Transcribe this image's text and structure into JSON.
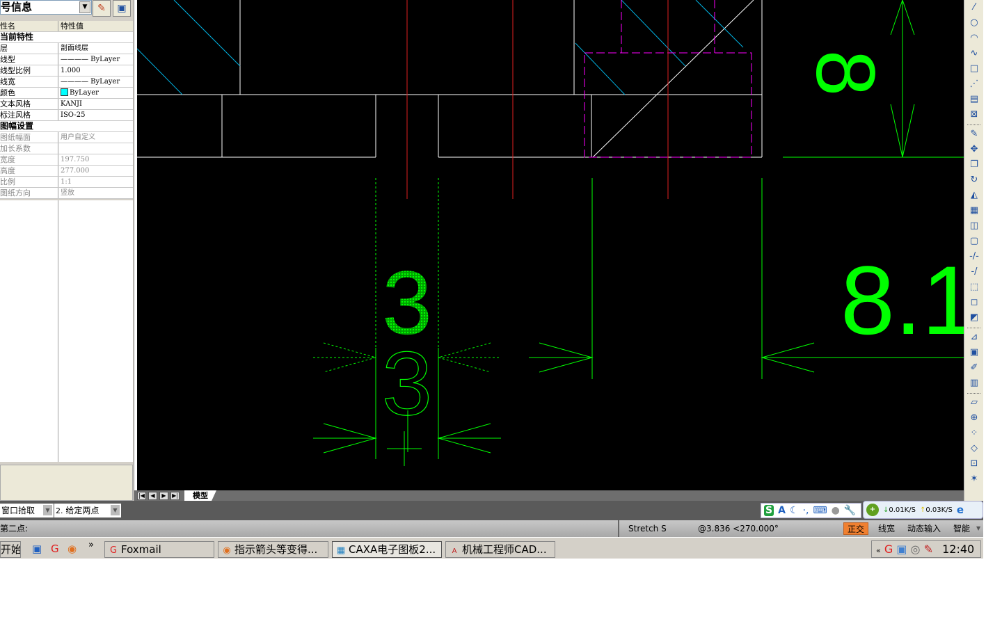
{
  "panel": {
    "title": "属性信息",
    "title_visible": "号信息",
    "col_name": "性名",
    "col_value": "特性值",
    "sections": [
      {
        "label": "当前特性",
        "rows": [
          {
            "k": "层",
            "v": "剖面线层"
          },
          {
            "k": "线型",
            "v": "———— ByLayer"
          },
          {
            "k": "线型比例",
            "v": "1.000"
          },
          {
            "k": "线宽",
            "v": "———— ByLayer"
          },
          {
            "k": "颜色",
            "v": "ByLayer",
            "swatch": "#00ffff"
          },
          {
            "k": "文本风格",
            "v": "KANJI"
          },
          {
            "k": "标注风格",
            "v": "ISO-25"
          }
        ]
      },
      {
        "label": "图幅设置",
        "rows": [
          {
            "k": "图纸幅面",
            "v": "用户自定义"
          },
          {
            "k": "加长系数",
            "v": ""
          },
          {
            "k": "宽度",
            "v": "197.750"
          },
          {
            "k": "高度",
            "v": "277.000"
          },
          {
            "k": "比例",
            "v": "1:1"
          },
          {
            "k": "图纸方向",
            "v": "竖放"
          }
        ]
      }
    ]
  },
  "drawing": {
    "dim_8": "8",
    "dim_8_1": "8.1",
    "dim_3_filled": "3",
    "dim_3_outline": "3"
  },
  "tabs": {
    "model": "模型"
  },
  "cmd": {
    "option1": "窗口拾取",
    "option2_num": "2.",
    "option2": "给定两点",
    "prompt": "第二点:"
  },
  "ime": {
    "net_down": "0.01K/S",
    "net_up": "0.03K/S"
  },
  "status": {
    "command": "Stretch S",
    "coords": "@3.836 <270.000°",
    "ortho": "正交",
    "lineweight": "线宽",
    "dynamic_input": "动态输入",
    "smart": "智能"
  },
  "taskbar": {
    "start": "开始",
    "items": [
      "Foxmail",
      "指示箭头等变得...",
      "CAXA电子图板2...",
      "机械工程师CAD..."
    ],
    "clock": "12:40"
  },
  "colors": {
    "canvas": "#000000",
    "green": "#00ff00",
    "red": "#ff2020",
    "magenta": "#ff00ff",
    "cyan": "#00c0ff",
    "ortho": "#f08030"
  },
  "toolbar_icons": [
    "line-icon",
    "circle-icon",
    "arc-icon",
    "spline-icon",
    "rectangle-icon",
    "centerline-icon",
    "hatch-icon",
    "fill-icon",
    "sep",
    "delete-icon",
    "move-icon",
    "copy-icon",
    "rotate-icon",
    "mirror-icon",
    "array-icon",
    "scale-icon",
    "offset-icon",
    "trim-icon",
    "extend-icon",
    "stretch-icon",
    "break-icon",
    "chamfer-icon",
    "sep",
    "dimension-icon",
    "properties-icon",
    "erase-icon",
    "format-brush-icon",
    "sep",
    "block-icon",
    "insert-icon",
    "attribute-icon",
    "tag-icon",
    "match-icon",
    "explode-icon"
  ]
}
